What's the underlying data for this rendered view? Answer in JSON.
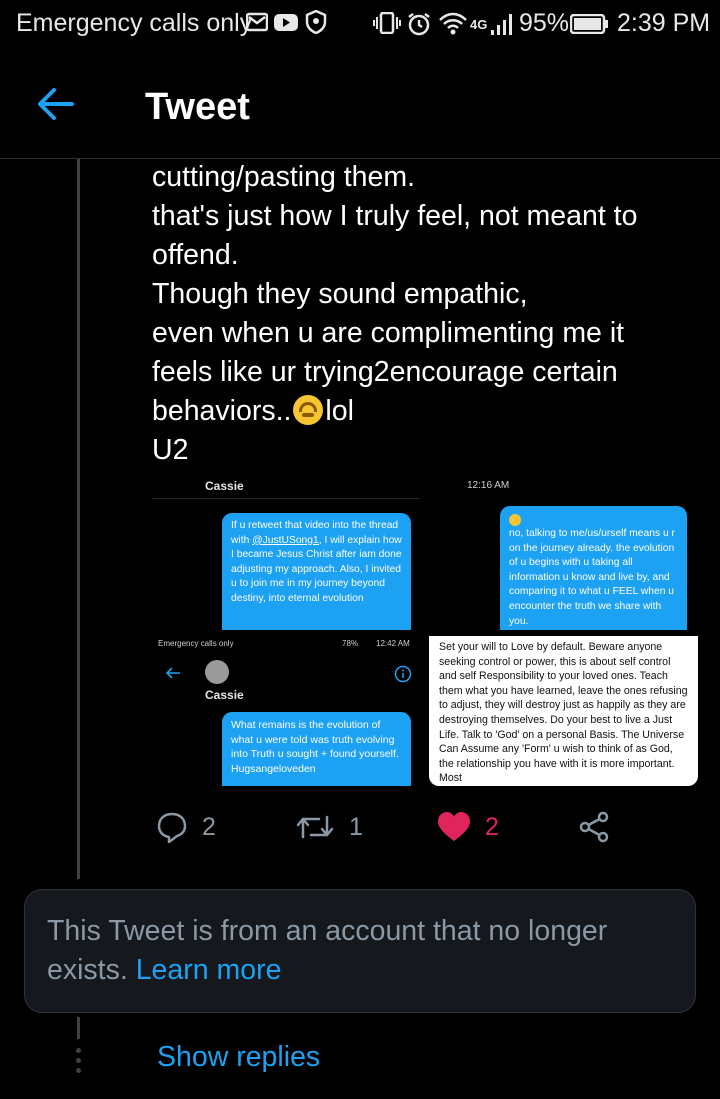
{
  "status_bar": {
    "carrier": "Emergency calls only",
    "battery_pct": "95%",
    "time": "2:39 PM",
    "network": "4G"
  },
  "header": {
    "title": "Tweet"
  },
  "tweet": {
    "lines": [
      "cutting/pasting them.",
      "that's just how I truly feel, not meant to",
      "offend.",
      "Though they sound empathic,",
      "even when u are complimenting me it",
      "feels like ur trying2encourage certain",
      "behaviors..",
      "U2"
    ],
    "lol": "lol",
    "media": {
      "shot1": {
        "contact": "Cassie",
        "time": "12:16 AM",
        "left_bubble_pre": "If u retweet that video into the thread with ",
        "left_bubble_mention": "@JustUSong1",
        "left_bubble_post": ", I will explain how I became Jesus Christ after iam done adjusting my approach. Also, I invited u to join me in my journey beyond destiny, into eternal evolution",
        "right_bubble": "no, talking to me/us/urself means u r on the journey already. the evolution of u begins with u taking all information u know and live by, and comparing it to what u FEEL when u encounter the truth we share with you."
      },
      "shot2": {
        "status_left": "Emergency calls only",
        "battery": "78%",
        "time": "12:42 AM",
        "contact": "Cassie",
        "bubble": "What remains is the evolution of what u were told was truth evolving into Truth u sought + found yourself. Hugsangeloveden"
      },
      "shot3": {
        "text": "Set your will to Love by default. Beware anyone seeking control or power, this is about self control and self Responsibility to your loved ones.  Teach them what you have learned, leave the ones refusing to adjust, they will destroy just as happily as they are destroying themselves. Do your best to live a Just Life. Talk to 'God' on a personal Basis. The Universe Can Assume any 'Form' u wish to think of as God, the relationship you have with it is more important. Most"
      }
    },
    "actions": {
      "replies": "2",
      "retweets": "1",
      "likes": "2"
    }
  },
  "notice": {
    "text": "This Tweet is from an account that no longer exists.",
    "link": "Learn more"
  },
  "show_replies": "Show replies",
  "colors": {
    "accent": "#1da1f2",
    "like": "#e0245e",
    "muted": "#8b98a5",
    "background": "#000000"
  }
}
